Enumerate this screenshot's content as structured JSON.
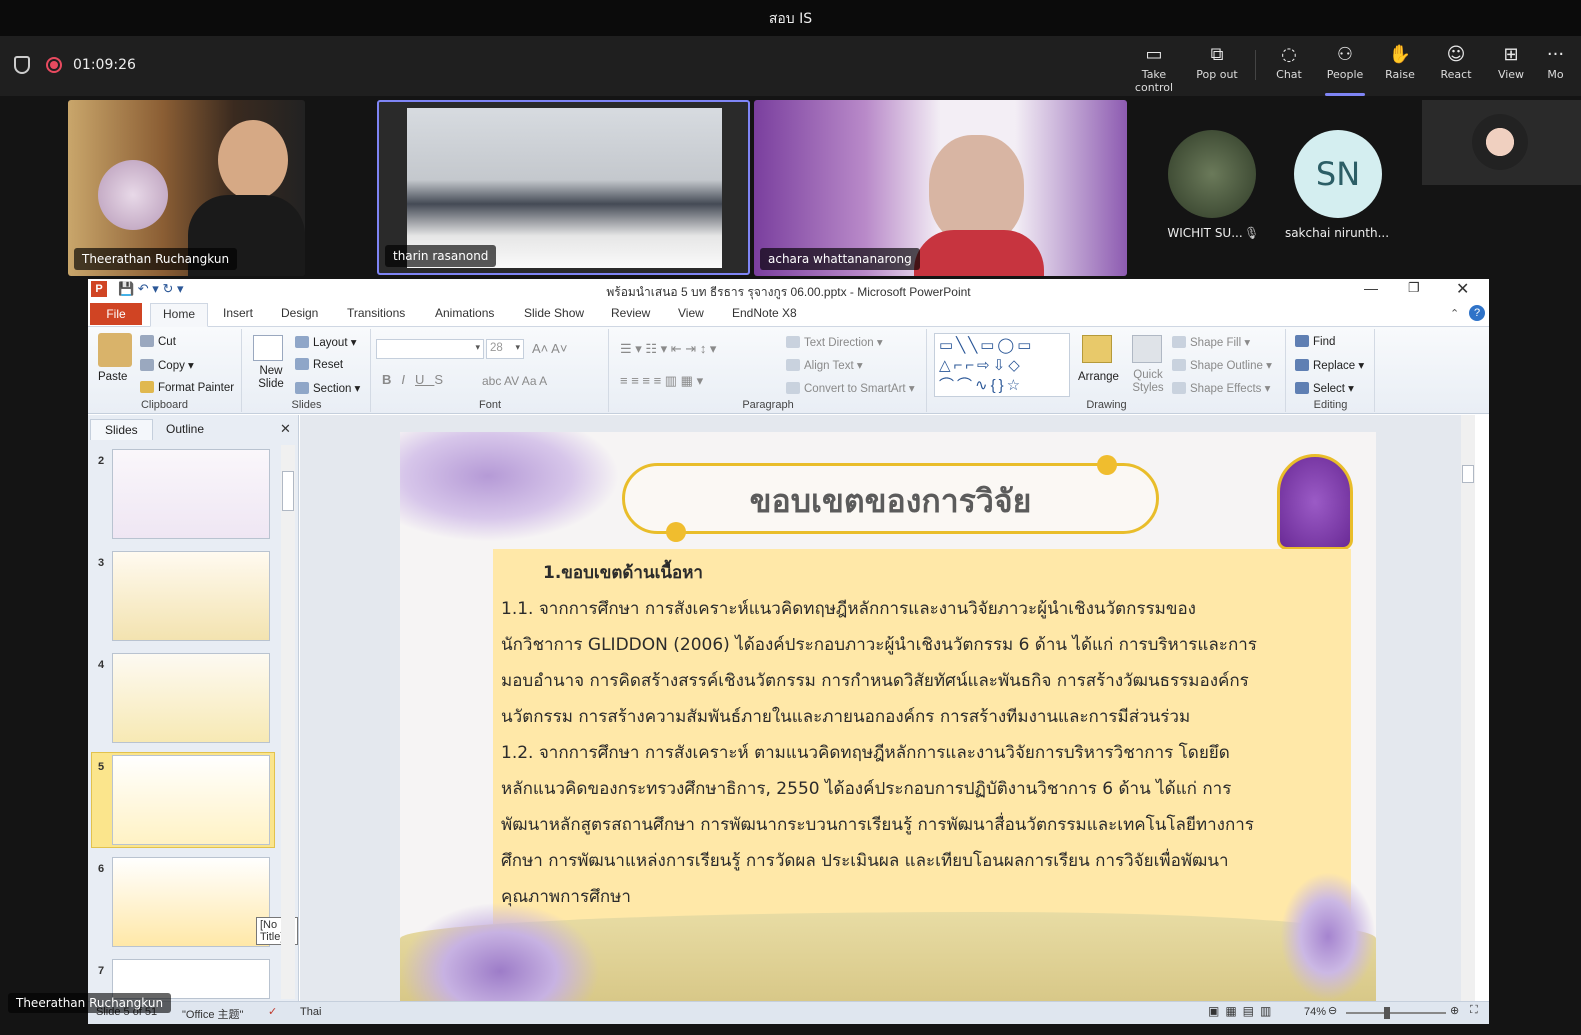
{
  "meeting": {
    "title": "สอบ IS",
    "timer": "01:09:26",
    "toolbar": [
      {
        "label": "Take control",
        "icon": "take-control-icon"
      },
      {
        "label": "Pop out",
        "icon": "pop-out-icon"
      },
      {
        "label": "Chat",
        "icon": "chat-icon"
      },
      {
        "label": "People",
        "icon": "people-icon"
      },
      {
        "label": "Raise",
        "icon": "raise-hand-icon"
      },
      {
        "label": "React",
        "icon": "react-icon"
      },
      {
        "label": "View",
        "icon": "view-icon"
      },
      {
        "label": "Mo",
        "icon": "more-icon"
      }
    ],
    "accent": "#7f85f5"
  },
  "participants": {
    "p1": "Theerathan Ruchangkun",
    "p2": "tharin rasanond",
    "p3": "achara whattananarong",
    "p4": "WICHIT SU...",
    "p5": "sakchai nirunth...",
    "p5_initials": "SN",
    "self_overlay": "Theerathan Ruchangkun"
  },
  "ppt": {
    "window_title": "พร้อมนำเสนอ 5 บท ธีรธาร  รุจางกูร 06.00.pptx  -  Microsoft PowerPoint",
    "tabs": [
      "File",
      "Home",
      "Insert",
      "Design",
      "Transitions",
      "Animations",
      "Slide Show",
      "Review",
      "View",
      "EndNote X8"
    ],
    "ribbon": {
      "clipboard": {
        "paste": "Paste",
        "cut": "Cut",
        "copy": "Copy",
        "format_painter": "Format Painter",
        "group": "Clipboard"
      },
      "slides": {
        "new_slide": "New Slide",
        "layout": "Layout",
        "reset": "Reset",
        "section": "Section",
        "group": "Slides"
      },
      "font": {
        "size": "28",
        "group": "Font"
      },
      "paragraph": {
        "text_direction": "Text Direction",
        "align_text": "Align Text",
        "convert": "Convert to SmartArt",
        "group": "Paragraph"
      },
      "drawing": {
        "arrange": "Arrange",
        "quick_styles": "Quick Styles",
        "shape_fill": "Shape Fill",
        "shape_outline": "Shape Outline",
        "shape_effects": "Shape Effects",
        "group": "Drawing"
      },
      "editing": {
        "find": "Find",
        "replace": "Replace",
        "select": "Select",
        "group": "Editing"
      }
    },
    "pane": {
      "tab_slides": "Slides",
      "tab_outline": "Outline",
      "numbers": [
        "2",
        "3",
        "4",
        "5",
        "6",
        "7"
      ],
      "tooltip": "[No Title]"
    },
    "slide": {
      "title": "ขอบเขตของการวิจัย",
      "heading": "1.ขอบเขตด้านเนื้อหา",
      "lines": [
        "       1.1. จากการศึกษา การสังเคราะห์แนวคิดทฤษฎีหลักการและงานวิจัยภาวะผู้นำเชิงนวัตกรรมของ",
        "นักวิชาการ GLIDDON (2006) ได้องค์ประกอบภาวะผู้นำเชิงนวัตกรรม 6 ด้าน ได้แก่ การบริหารและการ",
        "มอบอำนาจ การคิดสร้างสรรค์เชิงนวัตกรรม  การกำหนดวิสัยทัศน์และพันธกิจ  การสร้างวัฒนธรรมองค์กร",
        "นวัตกรรม  การสร้างความสัมพันธ์ภายในและภายนอกองค์กร  การสร้างทีมงานและการมีส่วนร่วม",
        "       1.2. จากการศึกษา การสังเคราะห์ ตามแนวคิดทฤษฎีหลักการและงานวิจัยการบริหารวิชาการ โดยยึด",
        "หลักแนวคิดของกระทรวงศึกษาธิการ, 2550 ได้องค์ประกอบการปฏิบัติงานวิชาการ 6 ด้าน ได้แก่ การ",
        "พัฒนาหลักสูตรสถานศึกษา การพัฒนากระบวนการเรียนรู้ การพัฒนาสื่อนวัตกรรมและเทคโนโลยีทางการ",
        "ศึกษา การพัฒนาแหล่งการเรียนรู้ การวัดผล ประเมินผล และเทียบโอนผลการเรียน การวิจัยเพื่อพัฒนา",
        "คุณภาพการศึกษา"
      ]
    },
    "status": {
      "slide": "Slide 5 of 51",
      "theme": "\"Office 主题\"",
      "language": "Thai",
      "zoom": "74%"
    }
  }
}
